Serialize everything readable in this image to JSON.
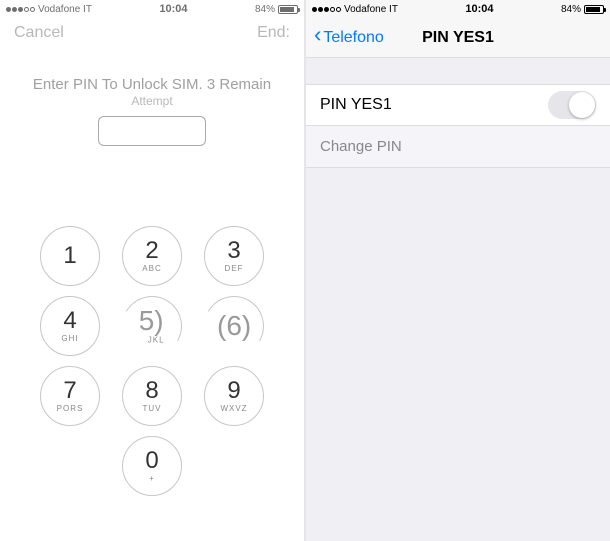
{
  "left": {
    "status": {
      "carrier": "Vodafone IT",
      "time": "10:04",
      "battery_pct": "84%"
    },
    "nav": {
      "cancel": "Cancel",
      "end": "End:"
    },
    "prompt": {
      "title": "Enter PIN To Unlock SIM. 3 Remain",
      "sub": "Attempt"
    },
    "keys": {
      "k1": {
        "d": "1",
        "l": ""
      },
      "k2": {
        "d": "2",
        "l": "ABC"
      },
      "k3": {
        "d": "3",
        "l": "DEF"
      },
      "k4": {
        "d": "4",
        "l": "GHI"
      },
      "k5": {
        "d": "5)",
        "l": "JKL"
      },
      "k6": {
        "d": "(6)",
        "l": ""
      },
      "k7": {
        "d": "7",
        "l": "Pors"
      },
      "k8": {
        "d": "8",
        "l": "TUV"
      },
      "k9": {
        "d": "9",
        "l": "Wxvz"
      },
      "k0": {
        "d": "0",
        "l": "+"
      }
    }
  },
  "right": {
    "status": {
      "carrier": "Vodafone IT",
      "time": "10:04",
      "battery_pct": "84%"
    },
    "nav": {
      "back": "Telefono",
      "title": "PIN YES1"
    },
    "rows": {
      "pin_label": "PIN YES1",
      "change": "Change PIN"
    }
  }
}
